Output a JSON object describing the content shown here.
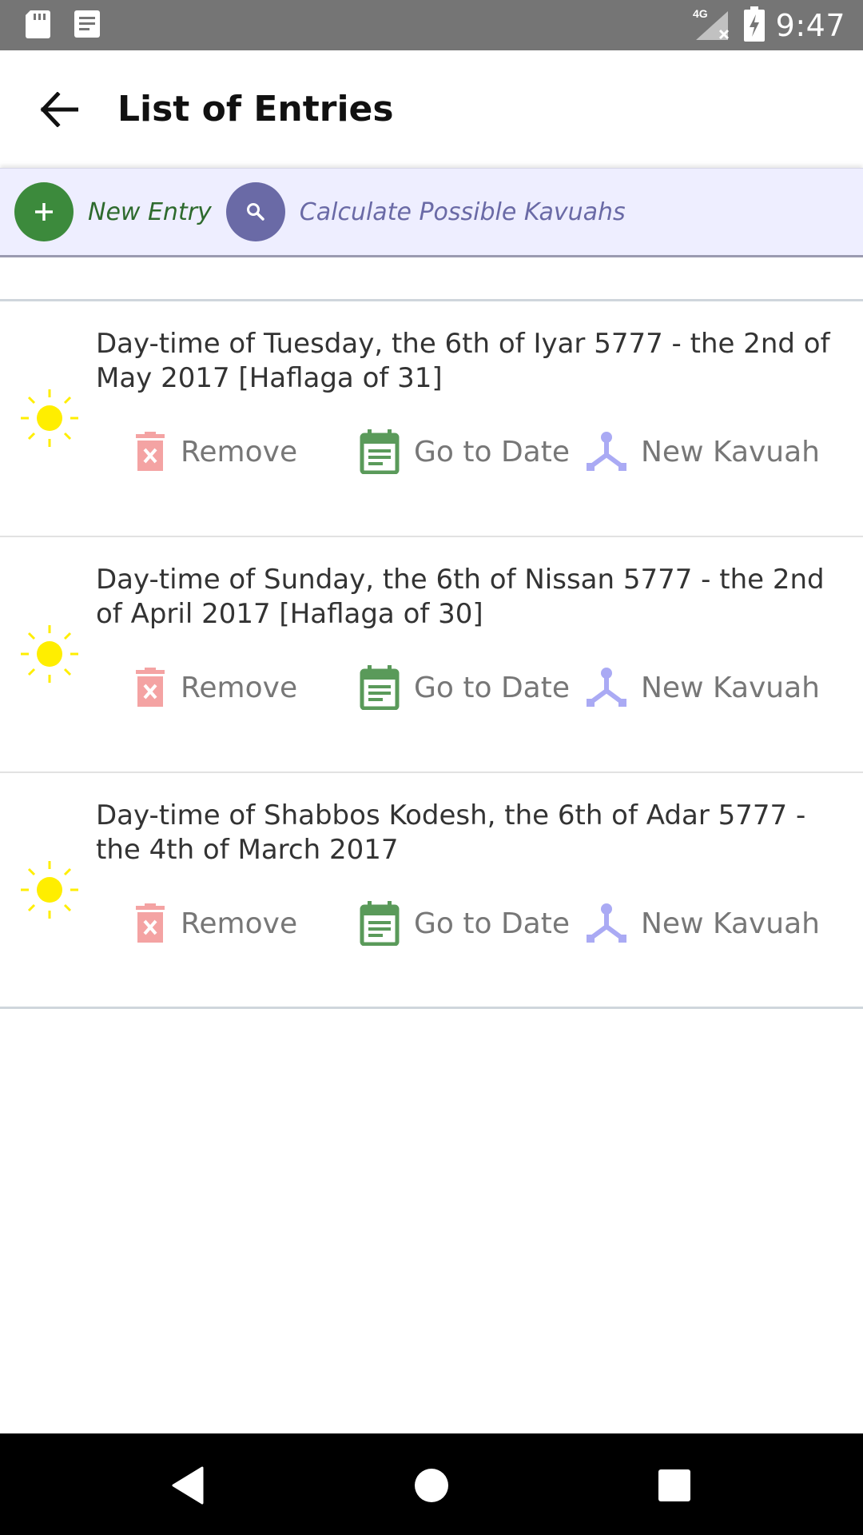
{
  "status_bar": {
    "time": "9:47",
    "network": "4G",
    "icons": [
      "sd-card-icon",
      "notes-icon",
      "signal-icon",
      "battery-charging-icon"
    ]
  },
  "app_bar": {
    "title": "List of Entries",
    "back_icon": "arrow-left-icon"
  },
  "toolbar": {
    "new_entry_label": "New Entry",
    "calculate_label": "Calculate Possible Kavuahs",
    "new_entry_icon": "plus-icon",
    "calculate_icon": "search-icon"
  },
  "entries": [
    {
      "text": "Day-time of Tuesday, the 6th of Iyar 5777 - the 2nd of May 2017 [Haflaga of 31]",
      "icon": "sun-icon"
    },
    {
      "text": "Day-time of Sunday, the 6th of Nissan 5777 - the 2nd of April 2017 [Haflaga of 30]",
      "icon": "sun-icon"
    },
    {
      "text": "Day-time of Shabbos Kodesh, the 6th of Adar 5777 - the 4th of March 2017",
      "icon": "sun-icon"
    }
  ],
  "actions": {
    "remove_label": "Remove",
    "goto_label": "Go to Date",
    "kavuah_label": "New Kavuah"
  },
  "colors": {
    "status_bar": "#757575",
    "toolbar_bg": "#eeeeff",
    "new_entry_green": "#3c8a3c",
    "calculate_purple": "#6a6aa6",
    "remove_pink": "#f4a3a3",
    "goto_green": "#5a9a5a",
    "kavuah_lavender": "#aaaaf4",
    "sun_yellow": "#ffee00"
  }
}
